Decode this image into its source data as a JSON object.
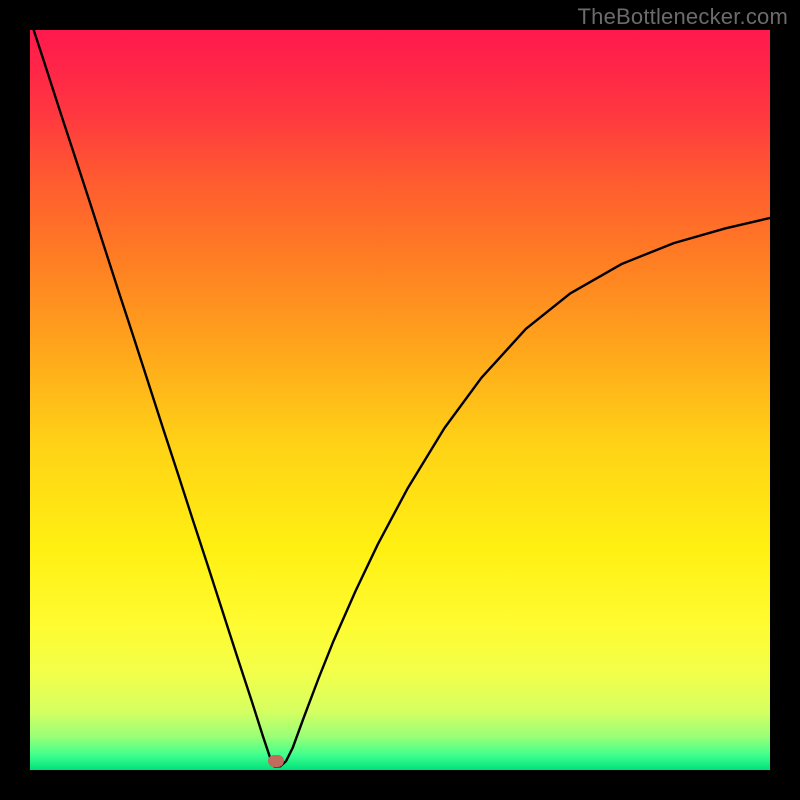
{
  "watermark": {
    "text": "TheBottlenecker.com"
  },
  "chart_data": {
    "type": "line",
    "title": "",
    "xlabel": "",
    "ylabel": "",
    "xlim": [
      0,
      100
    ],
    "ylim": [
      0,
      100
    ],
    "background_gradient_stops": [
      {
        "pos": 0.0,
        "color": "#ff1a4d"
      },
      {
        "pos": 0.05,
        "color": "#ff2548"
      },
      {
        "pos": 0.12,
        "color": "#ff3a3f"
      },
      {
        "pos": 0.2,
        "color": "#ff5a30"
      },
      {
        "pos": 0.3,
        "color": "#ff7a24"
      },
      {
        "pos": 0.42,
        "color": "#ffa21c"
      },
      {
        "pos": 0.56,
        "color": "#ffd216"
      },
      {
        "pos": 0.7,
        "color": "#fff012"
      },
      {
        "pos": 0.8,
        "color": "#fffb30"
      },
      {
        "pos": 0.87,
        "color": "#f2ff4a"
      },
      {
        "pos": 0.92,
        "color": "#d6ff60"
      },
      {
        "pos": 0.955,
        "color": "#99ff77"
      },
      {
        "pos": 0.98,
        "color": "#3fff8e"
      },
      {
        "pos": 1.0,
        "color": "#00e07a"
      }
    ],
    "series": [
      {
        "name": "bottleneck-curve",
        "color": "#000000",
        "stroke_width": 2.4,
        "x": [
          0.5,
          2,
          4,
          6,
          8,
          10,
          12,
          14,
          16,
          18,
          20,
          22,
          24,
          26,
          28,
          30,
          31.5,
          32.5,
          33.0,
          33.8,
          34.6,
          35.5,
          37,
          39,
          41,
          44,
          47,
          51,
          56,
          61,
          67,
          73,
          80,
          87,
          94,
          100
        ],
        "y": [
          100,
          95.4,
          89.2,
          83.1,
          77.0,
          70.8,
          64.6,
          58.5,
          52.3,
          46.1,
          40.0,
          33.8,
          27.7,
          21.5,
          15.3,
          9.2,
          4.5,
          1.5,
          0.5,
          0.5,
          1.2,
          3.0,
          7.1,
          12.4,
          17.4,
          24.2,
          30.5,
          38.0,
          46.2,
          53.0,
          59.6,
          64.4,
          68.4,
          71.2,
          73.2,
          74.6
        ]
      }
    ],
    "marker": {
      "x": 33.3,
      "y": 1.2,
      "color": "#c26a5c"
    }
  }
}
